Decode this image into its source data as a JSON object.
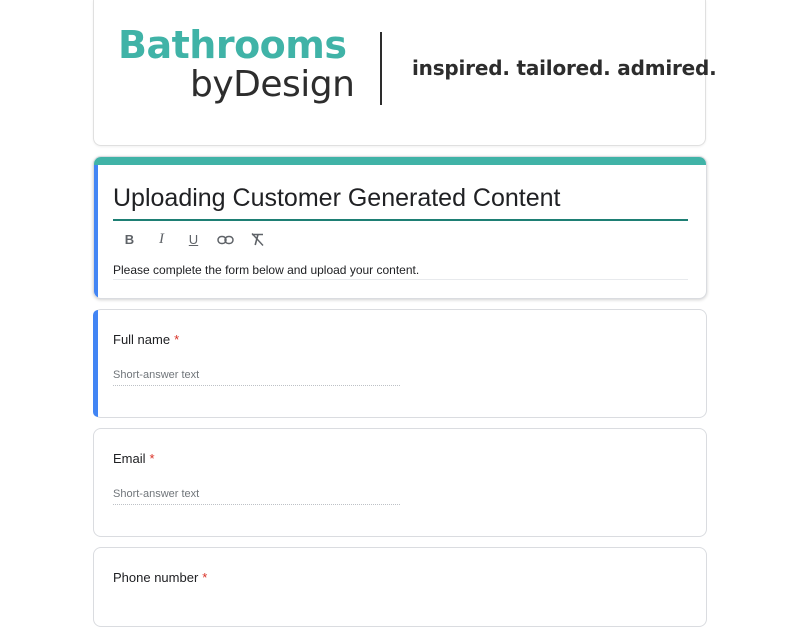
{
  "brand": {
    "line1": "Bathrooms",
    "line2": "byDesign",
    "tagline": "inspired. tailored. admired.",
    "colors": {
      "teal": "#40b3a7",
      "dark": "#2d2d2d"
    }
  },
  "form": {
    "title": "Uploading Customer Generated Content",
    "description": "Please complete the form below and upload your content.",
    "toolbar": {
      "bold": "B",
      "italic": "I",
      "underline": "U",
      "link_icon": "link-icon",
      "clear_format_icon": "clear-formatting-icon"
    },
    "accent_color": "#40b3a7",
    "focus_color": "#4285f4"
  },
  "questions": [
    {
      "label": "Full name",
      "required": "*",
      "placeholder": "Short-answer text"
    },
    {
      "label": "Email",
      "required": "*",
      "placeholder": "Short-answer text"
    },
    {
      "label": "Phone number",
      "required": "*"
    }
  ]
}
